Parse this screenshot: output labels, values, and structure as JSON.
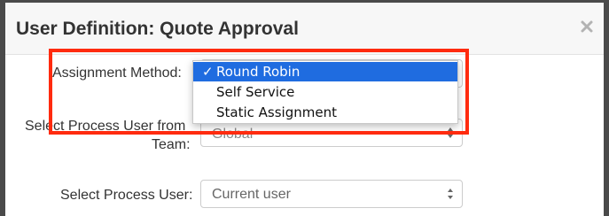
{
  "dialog": {
    "title": "User Definition: Quote Approval",
    "close_icon": "close-icon"
  },
  "form": {
    "assignment_method_label": "Assignment Method:",
    "process_user_team_label_line1": "Select Process User from",
    "process_user_team_label_line2": "Team:",
    "process_user_team_value": "Global",
    "process_user_label": "Select Process User:",
    "process_user_value": "Current user"
  },
  "assignment_dropdown": {
    "selected": "Round Robin",
    "check": "✓",
    "options": [
      "Round Robin",
      "Self Service",
      "Static Assignment"
    ]
  },
  "colors": {
    "highlight": "#ff2b0f",
    "selection": "#1f6ce0"
  }
}
